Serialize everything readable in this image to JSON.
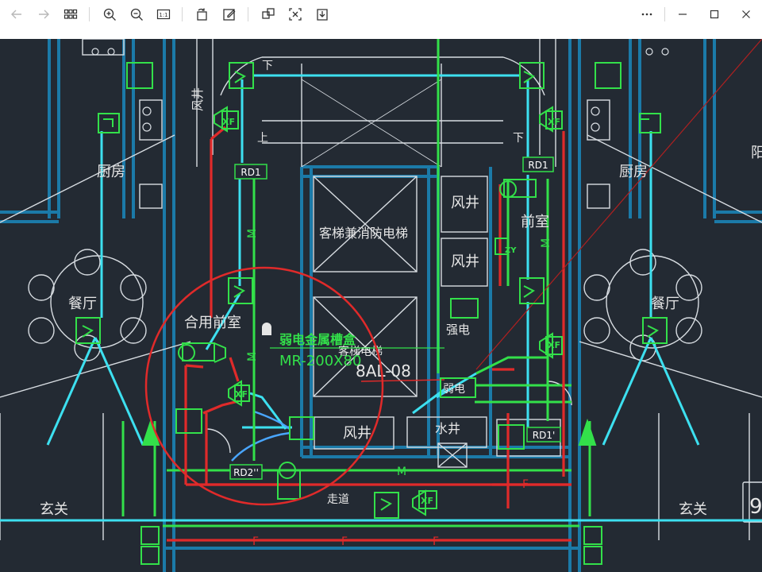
{
  "toolbar": {
    "back_icon": "arrow-left-icon",
    "forward_icon": "arrow-right-icon",
    "grid_icon": "grid-view-icon",
    "zoom_in_icon": "zoom-in-icon",
    "zoom_out_icon": "zoom-out-icon",
    "actual_size_label": "1:1",
    "rotate_icon": "rotate-icon",
    "edit_icon": "edit-icon",
    "crop_icon": "crop-icon",
    "fit_icon": "fit-screen-icon",
    "save_icon": "download-icon",
    "more_icon": "more-icon"
  },
  "window": {
    "minimize_icon": "minimize-icon",
    "maximize_icon": "maximize-icon",
    "close_icon": "close-icon"
  },
  "drawing": {
    "rooms": {
      "kitchen_left": "厨房",
      "kitchen_right": "厨房",
      "dining_left": "餐厅",
      "dining_right": "餐厅",
      "entry_left": "玄关",
      "entry_right": "玄关",
      "shared_lobby": "合用前室",
      "front_room": "前室",
      "corridor": "走道",
      "air_shaft_top": "风井",
      "air_shaft_mid": "风井",
      "air_shaft_bottom": "风井",
      "air_shaft_vertical": "风井",
      "water_shaft": "水井",
      "strong_power": "强电",
      "weak_power": "弱电",
      "elevator": "客梯兼消防电梯",
      "elevator_2": "客梯电梯",
      "balcony_partial": "阳"
    },
    "stairs": {
      "down_left": "下",
      "up_left": "上",
      "down_right": "下"
    },
    "tags": {
      "rd1_left": "RD1",
      "rd1_right": "RD1",
      "rd1_prime": "RD1'",
      "rd2_prime": "RD2''",
      "xf": "XF",
      "zy": "ZY",
      "m": "M",
      "f": "F",
      "panel_code": "8AL-08",
      "sheet_no": "9"
    },
    "annotations": {
      "tray_title": "弱电金属槽盒",
      "tray_spec": "MR-200X80"
    },
    "colors": {
      "background": "#232a33",
      "wall": "#1b7aa8",
      "cyan": "#3de0f0",
      "green": "#33e04a",
      "red": "#e02a2a",
      "white_line": "#d8dde2"
    }
  }
}
